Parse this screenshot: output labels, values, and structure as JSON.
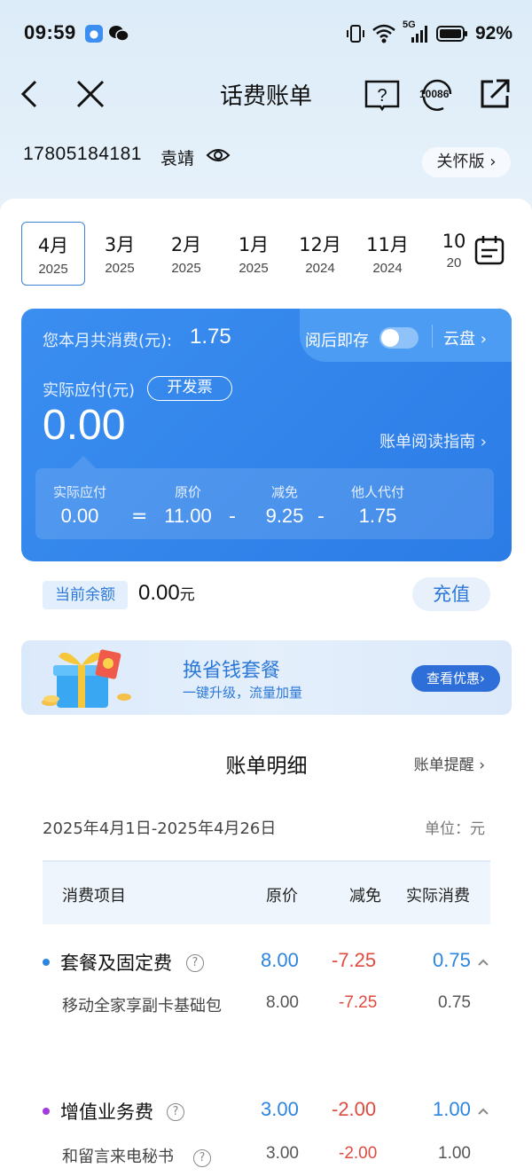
{
  "status": {
    "time": "09:59",
    "battery": "92%",
    "network": "5G"
  },
  "nav": {
    "title": "话费账单",
    "service_icon_text": "10086"
  },
  "account": {
    "number": "17805184181",
    "name": "袁靖",
    "care_label": "关怀版 ›"
  },
  "months": [
    {
      "month": "4月",
      "year": "2025"
    },
    {
      "month": "3月",
      "year": "2025"
    },
    {
      "month": "2月",
      "year": "2025"
    },
    {
      "month": "1月",
      "year": "2025"
    },
    {
      "month": "12月",
      "year": "2024"
    },
    {
      "month": "11月",
      "year": "2024"
    },
    {
      "month": "10",
      "year": "20"
    }
  ],
  "bill": {
    "total_label": "您本月共消费(元):",
    "total_value": "1.75",
    "save_label": "阅后即存",
    "save_enabled": false,
    "cloud_label": "云盘 ›",
    "payable_label": "实际应付(元)",
    "invoice_label": "开发票",
    "payable_value": "0.00",
    "guide_label": "账单阅读指南 ›",
    "formula": [
      {
        "label": "实际应付",
        "value": "0.00"
      },
      {
        "label": "原价",
        "value": "11.00"
      },
      {
        "label": "减免",
        "value": "9.25"
      },
      {
        "label": "他人代付",
        "value": "1.75"
      }
    ],
    "ops": [
      "=",
      "-",
      "-"
    ]
  },
  "balance": {
    "label": "当前余额",
    "value": "0.00",
    "unit": "元",
    "recharge_label": "充值"
  },
  "promo": {
    "title": "换省钱套餐",
    "subtitle": "一键升级，流量加量",
    "button": "查看优惠›"
  },
  "detail": {
    "title": "账单明细",
    "remind_label": "账单提醒 ›",
    "period": "2025年4月1日-2025年4月26日",
    "unit": "单位：元",
    "headers": [
      "消费项目",
      "原价",
      "减免",
      "实际消费"
    ],
    "categories": [
      {
        "name": "套餐及固定费",
        "dot_color": "#2c85e0",
        "original": "8.00",
        "discount": "-7.25",
        "actual": "0.75",
        "items": [
          {
            "name": "移动全家享副卡基础包",
            "original": "8.00",
            "discount": "-7.25",
            "actual": "0.75"
          }
        ]
      },
      {
        "name": "增值业务费",
        "dot_color": "#a23ae0",
        "original": "3.00",
        "discount": "-2.00",
        "actual": "1.00",
        "items": [
          {
            "name": "和留言来电秘书",
            "original": "3.00",
            "discount": "-2.00",
            "actual": "1.00"
          }
        ]
      }
    ]
  }
}
